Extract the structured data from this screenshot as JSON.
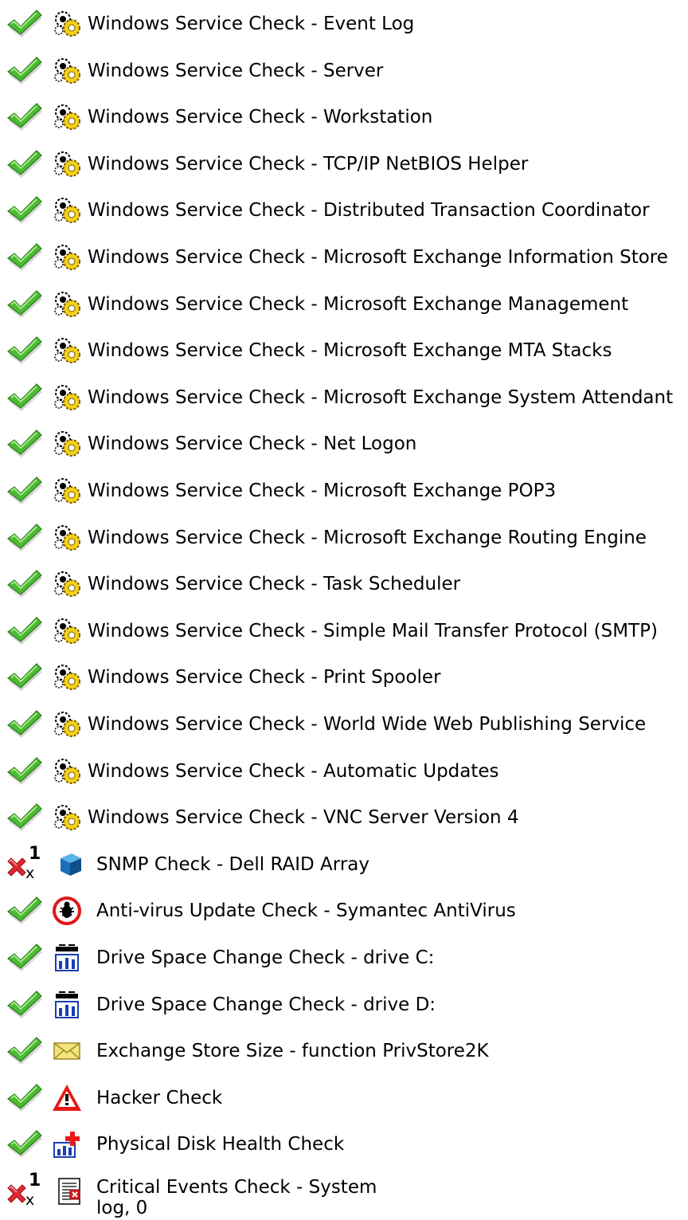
{
  "checks": [
    {
      "label": "Windows Service Check - Event Log",
      "status": "pass",
      "icon": "service-gears-icon"
    },
    {
      "label": "Windows Service Check - Server",
      "status": "pass",
      "icon": "service-gears-icon"
    },
    {
      "label": "Windows Service Check - Workstation",
      "status": "pass",
      "icon": "service-gears-icon"
    },
    {
      "label": "Windows Service Check - TCP/IP NetBIOS Helper",
      "status": "pass",
      "icon": "service-gears-icon"
    },
    {
      "label": "Windows Service Check - Distributed Transaction Coordinator",
      "status": "pass",
      "icon": "service-gears-icon"
    },
    {
      "label": "Windows Service Check - Microsoft Exchange Information Store",
      "status": "pass",
      "icon": "service-gears-icon"
    },
    {
      "label": "Windows Service Check - Microsoft Exchange Management",
      "status": "pass",
      "icon": "service-gears-icon"
    },
    {
      "label": "Windows Service Check - Microsoft Exchange MTA Stacks",
      "status": "pass",
      "icon": "service-gears-icon"
    },
    {
      "label": "Windows Service Check - Microsoft Exchange System Attendant",
      "status": "pass",
      "icon": "service-gears-icon"
    },
    {
      "label": "Windows Service Check - Net Logon",
      "status": "pass",
      "icon": "service-gears-icon"
    },
    {
      "label": "Windows Service Check - Microsoft Exchange POP3",
      "status": "pass",
      "icon": "service-gears-icon"
    },
    {
      "label": "Windows Service Check - Microsoft Exchange Routing Engine",
      "status": "pass",
      "icon": "service-gears-icon"
    },
    {
      "label": "Windows Service Check - Task Scheduler",
      "status": "pass",
      "icon": "service-gears-icon"
    },
    {
      "label": "Windows Service Check - Simple Mail Transfer Protocol (SMTP)",
      "status": "pass",
      "icon": "service-gears-icon"
    },
    {
      "label": "Windows Service Check - Print Spooler",
      "status": "pass",
      "icon": "service-gears-icon"
    },
    {
      "label": "Windows Service Check - World Wide Web Publishing Service",
      "status": "pass",
      "icon": "service-gears-icon"
    },
    {
      "label": "Windows Service Check - Automatic Updates",
      "status": "pass",
      "icon": "service-gears-icon"
    },
    {
      "label": "Windows Service Check - VNC Server Version 4",
      "status": "pass",
      "icon": "service-gears-icon"
    },
    {
      "label": "SNMP Check - Dell RAID Array",
      "status": "fail",
      "fail_count": "1",
      "fail_sub": "x",
      "icon": "snmp-cube-icon"
    },
    {
      "label": "Anti-virus Update Check - Symantec AntiVirus",
      "status": "pass",
      "icon": "antivirus-bug-icon"
    },
    {
      "label": "Drive Space Change Check - drive C:",
      "status": "pass",
      "icon": "drive-space-icon"
    },
    {
      "label": "Drive Space Change Check - drive D:",
      "status": "pass",
      "icon": "drive-space-icon"
    },
    {
      "label": "Exchange Store Size - function PrivStore2K",
      "status": "pass",
      "icon": "mail-envelope-icon"
    },
    {
      "label": "Hacker Check",
      "status": "pass",
      "icon": "warning-triangle-icon"
    },
    {
      "label": "Physical Disk Health Check",
      "status": "pass",
      "icon": "disk-health-icon"
    },
    {
      "label_line1": "Critical Events Check - System",
      "label_line2": "log, 0",
      "status": "fail",
      "fail_count": "1",
      "fail_sub": "x",
      "icon": "event-log-icon"
    }
  ],
  "colors": {
    "pass": "#3fae2a",
    "fail": "#d8202a"
  }
}
